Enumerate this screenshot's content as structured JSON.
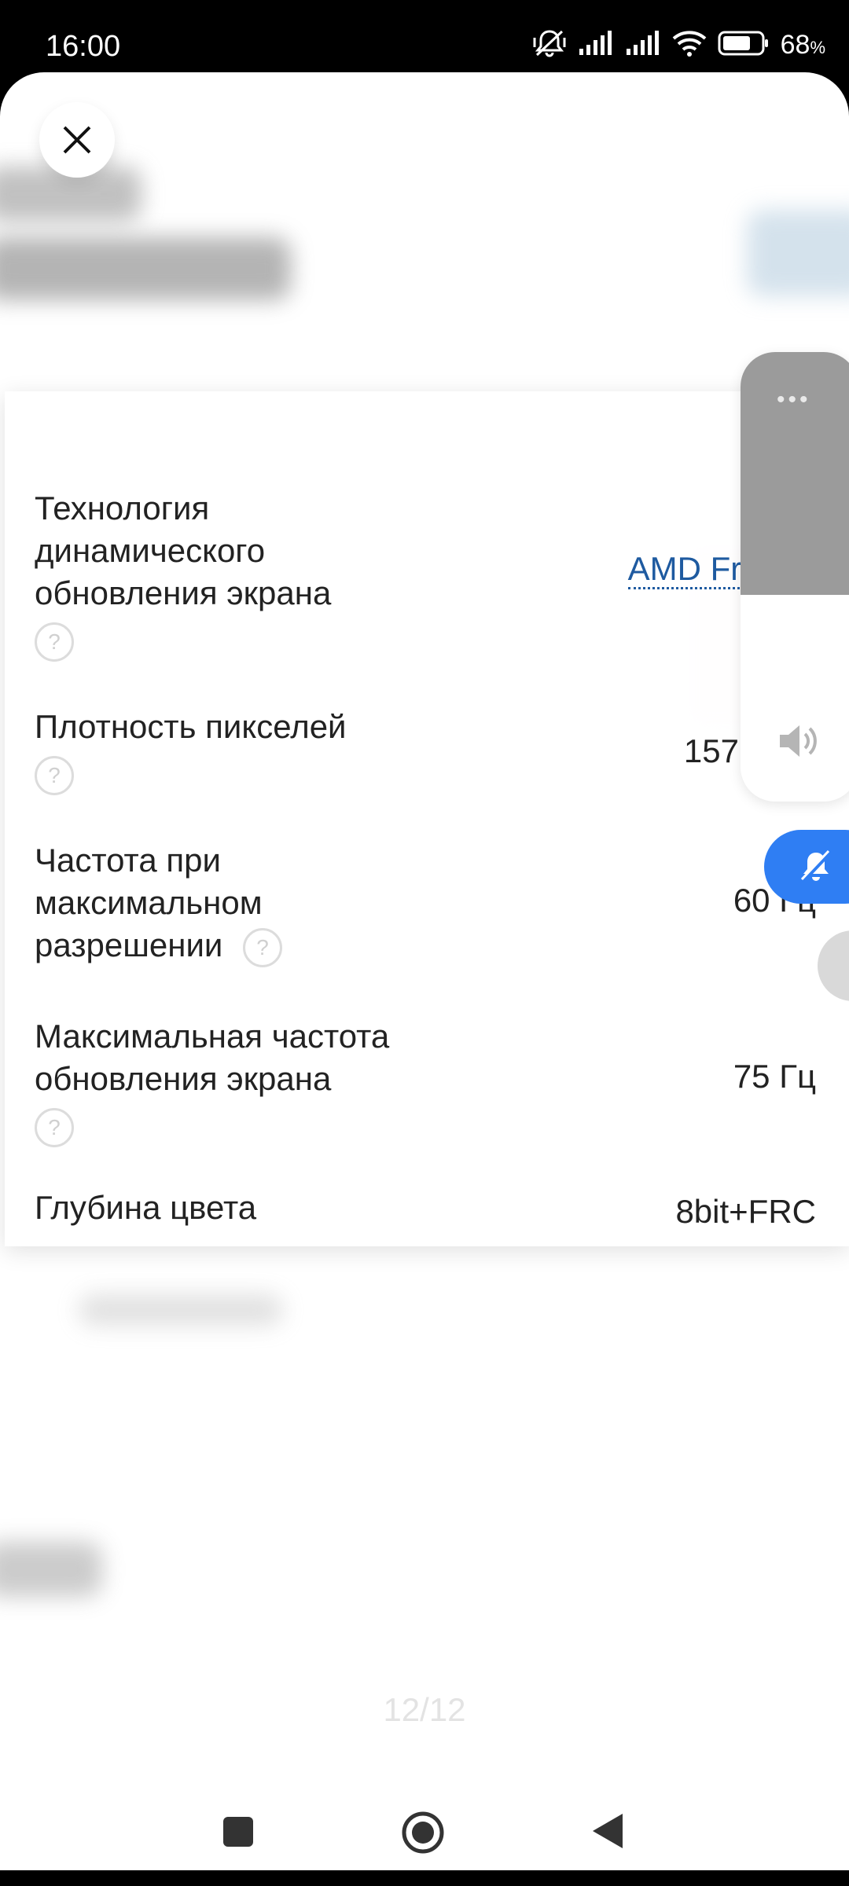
{
  "status_bar": {
    "time": "16:00",
    "battery_percent": "68",
    "battery_unit": "%"
  },
  "specs": [
    {
      "label": "Технология динамического обновления экрана",
      "value": "AMD Free",
      "has_help": true
    },
    {
      "label": "Плотность пикселей",
      "value": "157",
      "has_help": true
    },
    {
      "label": "Частота при максимальном разрешении",
      "value": "60 Гц",
      "has_help": true
    },
    {
      "label": "Максимальная частота обновления экрана",
      "value": "75 Гц",
      "has_help": true
    },
    {
      "label": "Глубина цвета",
      "value": "8bit+FRC",
      "has_help": false
    }
  ],
  "pager": "12/12",
  "help_glyph": "?",
  "volume": {
    "dots": "•••",
    "level": 0.54
  },
  "icons": {
    "close": "close-icon",
    "speaker": "speaker-icon",
    "mute": "bell-off-icon",
    "nav_recent": "square-icon",
    "nav_home": "circle-icon",
    "nav_back": "triangle-back-icon"
  },
  "colors": {
    "link": "#1e5aa0",
    "mute_button": "#2f7ef3",
    "volume_fill": "#9b9b9b"
  }
}
